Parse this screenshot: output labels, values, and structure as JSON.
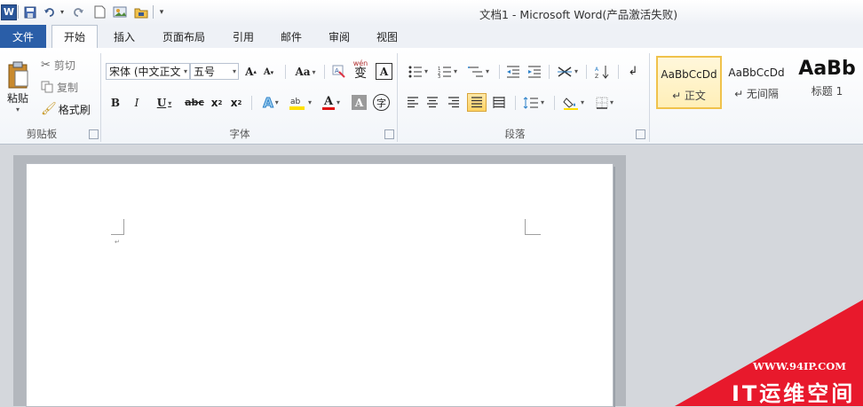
{
  "window": {
    "title": "文档1 - Microsoft Word(产品激活失败)",
    "app_icon": "word-icon"
  },
  "quick_access": {
    "items": [
      "save-icon",
      "undo-icon",
      "redo-icon",
      "new-document-icon",
      "image-icon",
      "folder-icon",
      "customize-dropdown-icon"
    ]
  },
  "tabs": [
    "文件",
    "开始",
    "插入",
    "页面布局",
    "引用",
    "邮件",
    "审阅",
    "视图"
  ],
  "active_tab": "开始",
  "ribbon": {
    "clipboard": {
      "group_label": "剪贴板",
      "paste_label": "粘贴",
      "cut_label": "剪切",
      "copy_label": "复制",
      "format_painter_label": "格式刷"
    },
    "font": {
      "group_label": "字体",
      "font_name": "宋体 (中文正文",
      "font_size": "五号",
      "grow_label": "A",
      "shrink_label": "A",
      "case_label": "Aa",
      "bold_label": "B",
      "italic_label": "I",
      "underline_label": "U",
      "strike_label": "abc",
      "subscript_label": "x",
      "superscript_label": "x",
      "font_color_label": "A",
      "shading_label": "A",
      "enclose_label": "字",
      "phonetic_label": "wén",
      "phonetic_char": "变",
      "border_char": "A"
    },
    "paragraph": {
      "group_label": "段落"
    },
    "styles": {
      "items": [
        {
          "sample": "AaBbCcDd",
          "name": "↵ 正文"
        },
        {
          "sample": "AaBbCcDd",
          "name": "↵ 无间隔"
        },
        {
          "sample": "AaBb",
          "name": "标题 1"
        }
      ]
    }
  },
  "document": {
    "paragraph_mark": "↵"
  },
  "watermark": {
    "url": "WWW.94IP.COM",
    "brand": "IT运维空间",
    "color": "#e8192c"
  }
}
